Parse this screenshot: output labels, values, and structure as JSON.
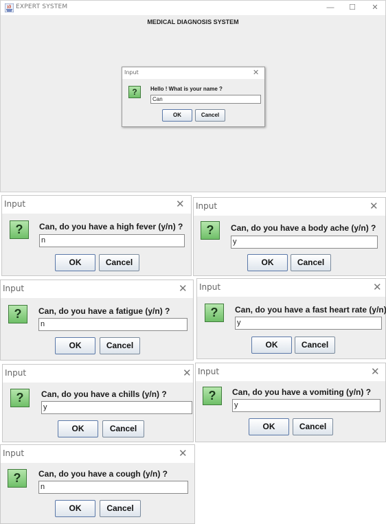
{
  "window": {
    "title": "EXPERT SYSTEM",
    "heading": "MEDICAL DIAGNOSIS SYSTEM",
    "min_glyph": "—",
    "max_glyph": "☐",
    "close_glyph": "✕"
  },
  "dialog_common": {
    "title": "Input",
    "close_glyph": "✕",
    "icon_glyph": "?",
    "ok_label": "OK",
    "cancel_label": "Cancel"
  },
  "name_dialog": {
    "prompt": "Hello ! What is your name ?",
    "value": "Can"
  },
  "questions": [
    {
      "prompt": "Can, do you have a high fever (y/n) ?",
      "value": "n"
    },
    {
      "prompt": "Can, do you have a body ache (y/n) ?",
      "value": "y"
    },
    {
      "prompt": "Can, do you have a fatigue (y/n) ?",
      "value": "n"
    },
    {
      "prompt": "Can, do you have a fast heart rate (y/n) ?",
      "value": "y"
    },
    {
      "prompt": "Can, do you have a chills (y/n) ?",
      "value": "y"
    },
    {
      "prompt": "Can, do you have a vomiting (y/n) ?",
      "value": "y"
    },
    {
      "prompt": "Can, do you have a cough (y/n) ?",
      "value": "n"
    }
  ]
}
